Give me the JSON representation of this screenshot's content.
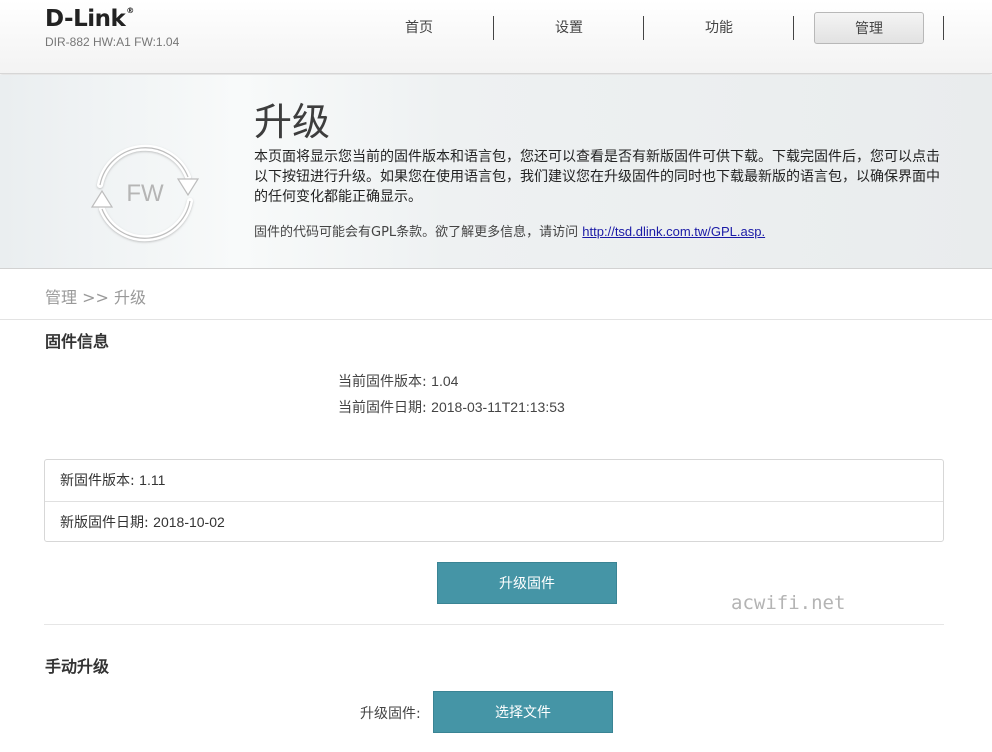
{
  "header": {
    "brand": "D-Link",
    "brand_mark": "®",
    "model": "DIR-882 HW:A1 FW:1.04",
    "nav": [
      "首页",
      "设置",
      "功能",
      "管理"
    ],
    "active_nav": "管理"
  },
  "banner": {
    "icon": "fw-refresh-icon",
    "icon_text": "FW",
    "title": "升级",
    "description": "本页面将显示您当前的固件版本和语言包，您还可以查看是否有新版固件可供下载。下载完固件后，您可以点击以下按钮进行升级。如果您在使用语言包，我们建议您在升级固件的同时也下载最新版的语言包，以确保界面中的任何变化都能正确显示。",
    "gpl_text": "固件的代码可能会有GPL条款。欲了解更多信息，请访问",
    "gpl_link": "http://tsd.dlink.com.tw/GPL.asp."
  },
  "breadcrumb": "管理 >> 升级",
  "firmware_info": {
    "title": "固件信息",
    "current_version_label": "当前固件版本:",
    "current_version": "1.04",
    "current_date_label": "当前固件日期:",
    "current_date": "2018-03-11T21:13:53",
    "new_version_label": "新固件版本:",
    "new_version": "1.11",
    "new_date_label": "新版固件日期:",
    "new_date": "2018-10-02",
    "upgrade_button": "升级固件"
  },
  "watermark": "acwifi.net",
  "manual_upgrade": {
    "title": "手动升级",
    "field_label": "升级固件:",
    "select_button": "选择文件"
  },
  "colors": {
    "button": "#4595a6",
    "link": "#1a1aa6"
  }
}
